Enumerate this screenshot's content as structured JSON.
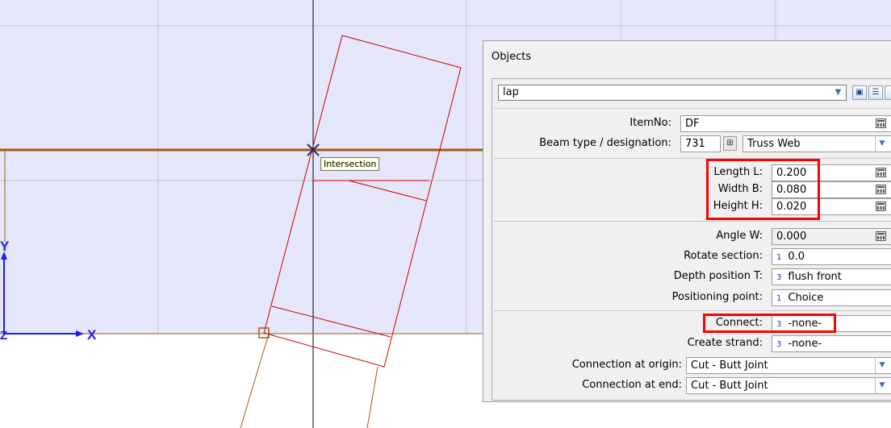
{
  "viewport": {
    "tooltip": "Intersection",
    "axis_x_label": "X",
    "axis_y_label": "Y",
    "axis_z_label": "Z"
  },
  "panel": {
    "title": "Objects",
    "selector_value": "lap",
    "rows": {
      "item_no": {
        "label": "ItemNo:",
        "value": "DF"
      },
      "beam_type": {
        "label": "Beam type / designation:",
        "code": "731",
        "value": "Truss Web"
      },
      "length": {
        "label": "Length L:",
        "value": "0.200"
      },
      "width": {
        "label": "Width B:",
        "value": "0.080"
      },
      "height": {
        "label": "Height H:",
        "value": "0.020"
      },
      "angle": {
        "label": "Angle W:",
        "value": "0.000"
      },
      "rotate": {
        "label": "Rotate section:",
        "num": "1",
        "value": "0.0"
      },
      "depth": {
        "label": "Depth position T:",
        "num": "3",
        "value": "flush front"
      },
      "positioning": {
        "label": "Positioning point:",
        "num": "1",
        "value": "Choice"
      },
      "connect": {
        "label": "Connect:",
        "num": "3",
        "value": "-none-"
      },
      "strand": {
        "label": "Create strand:",
        "num": "3",
        "value": "-none-"
      },
      "conn_origin": {
        "label": "Connection at origin:",
        "value": "Cut - Butt Joint"
      },
      "conn_end": {
        "label": "Connection at end:",
        "value": "Cut - Butt Joint"
      }
    }
  },
  "colors": {
    "viewport_bg": "#e6e6fa",
    "grid": "#c8c8c8",
    "beam_line": "#a05a14",
    "web_outline": "#cc0000",
    "axis": "#1a1aff",
    "highlight": "#ff0000"
  }
}
